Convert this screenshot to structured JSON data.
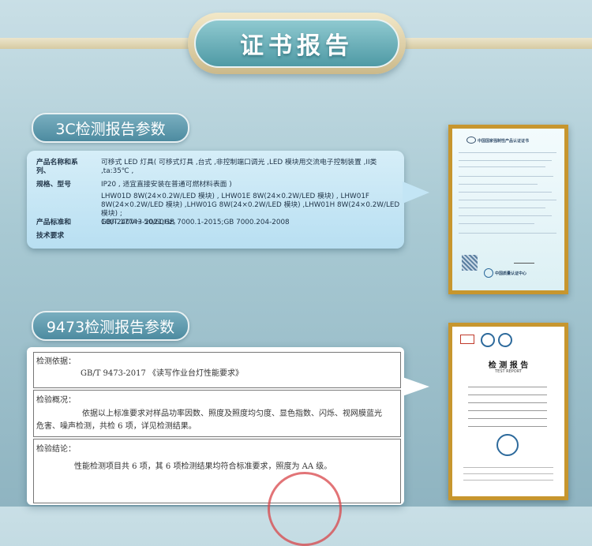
{
  "header": {
    "title": "证书报告"
  },
  "section1": {
    "title": "3C检测报告参数",
    "product_label_1": "产品名称和系列、",
    "product_label_2": "规格、型号",
    "product_value_lines": [
      "可移式  LED  灯具( 可移式灯具 ,台式 ,非控制端口调光 ,LED  模块用交流电子控制装置 ,II类 ,ta:35℃ ,",
      "IP20 , 适宜直接安装在普通可燃材料表面 )",
      "LHW01D 8W(24×0.2W/LED  模块) , LHW01E 8W(24×0.2W/LED  模块) , LHW01F",
      "8W(24×0.2W/LED  模块) ,LHW01G 8W(24×0.2W/LED  模块) ,LHW01H 8W(24×0.2W/LED  模块) ;",
      "100-240V～  50/60Hz。"
    ],
    "standard_label_1": "产品标准和",
    "standard_label_2": "技术要求",
    "standard_value": "GB/T 17743-2021;GB 7000.1-2015;GB 7000.204-2008"
  },
  "section2": {
    "title": "9473检测报告参数",
    "basis_label": "检测依据：",
    "basis_value": "GB/T  9473-2017  《读写作业台灯性能要求》",
    "overview_label": "检验概况：",
    "overview_line1": "依据以上标准要求对样品功率因数、照度及照度均匀度、显色指数、闪烁、视网膜蓝光",
    "overview_line2": "危害、噪声检测，共检 6 项，详见检测结果。",
    "conclusion_label": "检验结论：",
    "conclusion_value": "性能检测项目共 6 项，其 6 项检测结果均符合标准要求，照度为 AA 级。"
  },
  "cert1": {
    "header": "中国国家强制性产品认证证书",
    "footer": "中国质量认证中心"
  },
  "cert2": {
    "title": "检 测 报 告",
    "subtitle": "TEST  REPORT"
  },
  "colors": {
    "accent": "#4f9aa5",
    "frame": "#c7962e",
    "seal": "#d8454a"
  }
}
